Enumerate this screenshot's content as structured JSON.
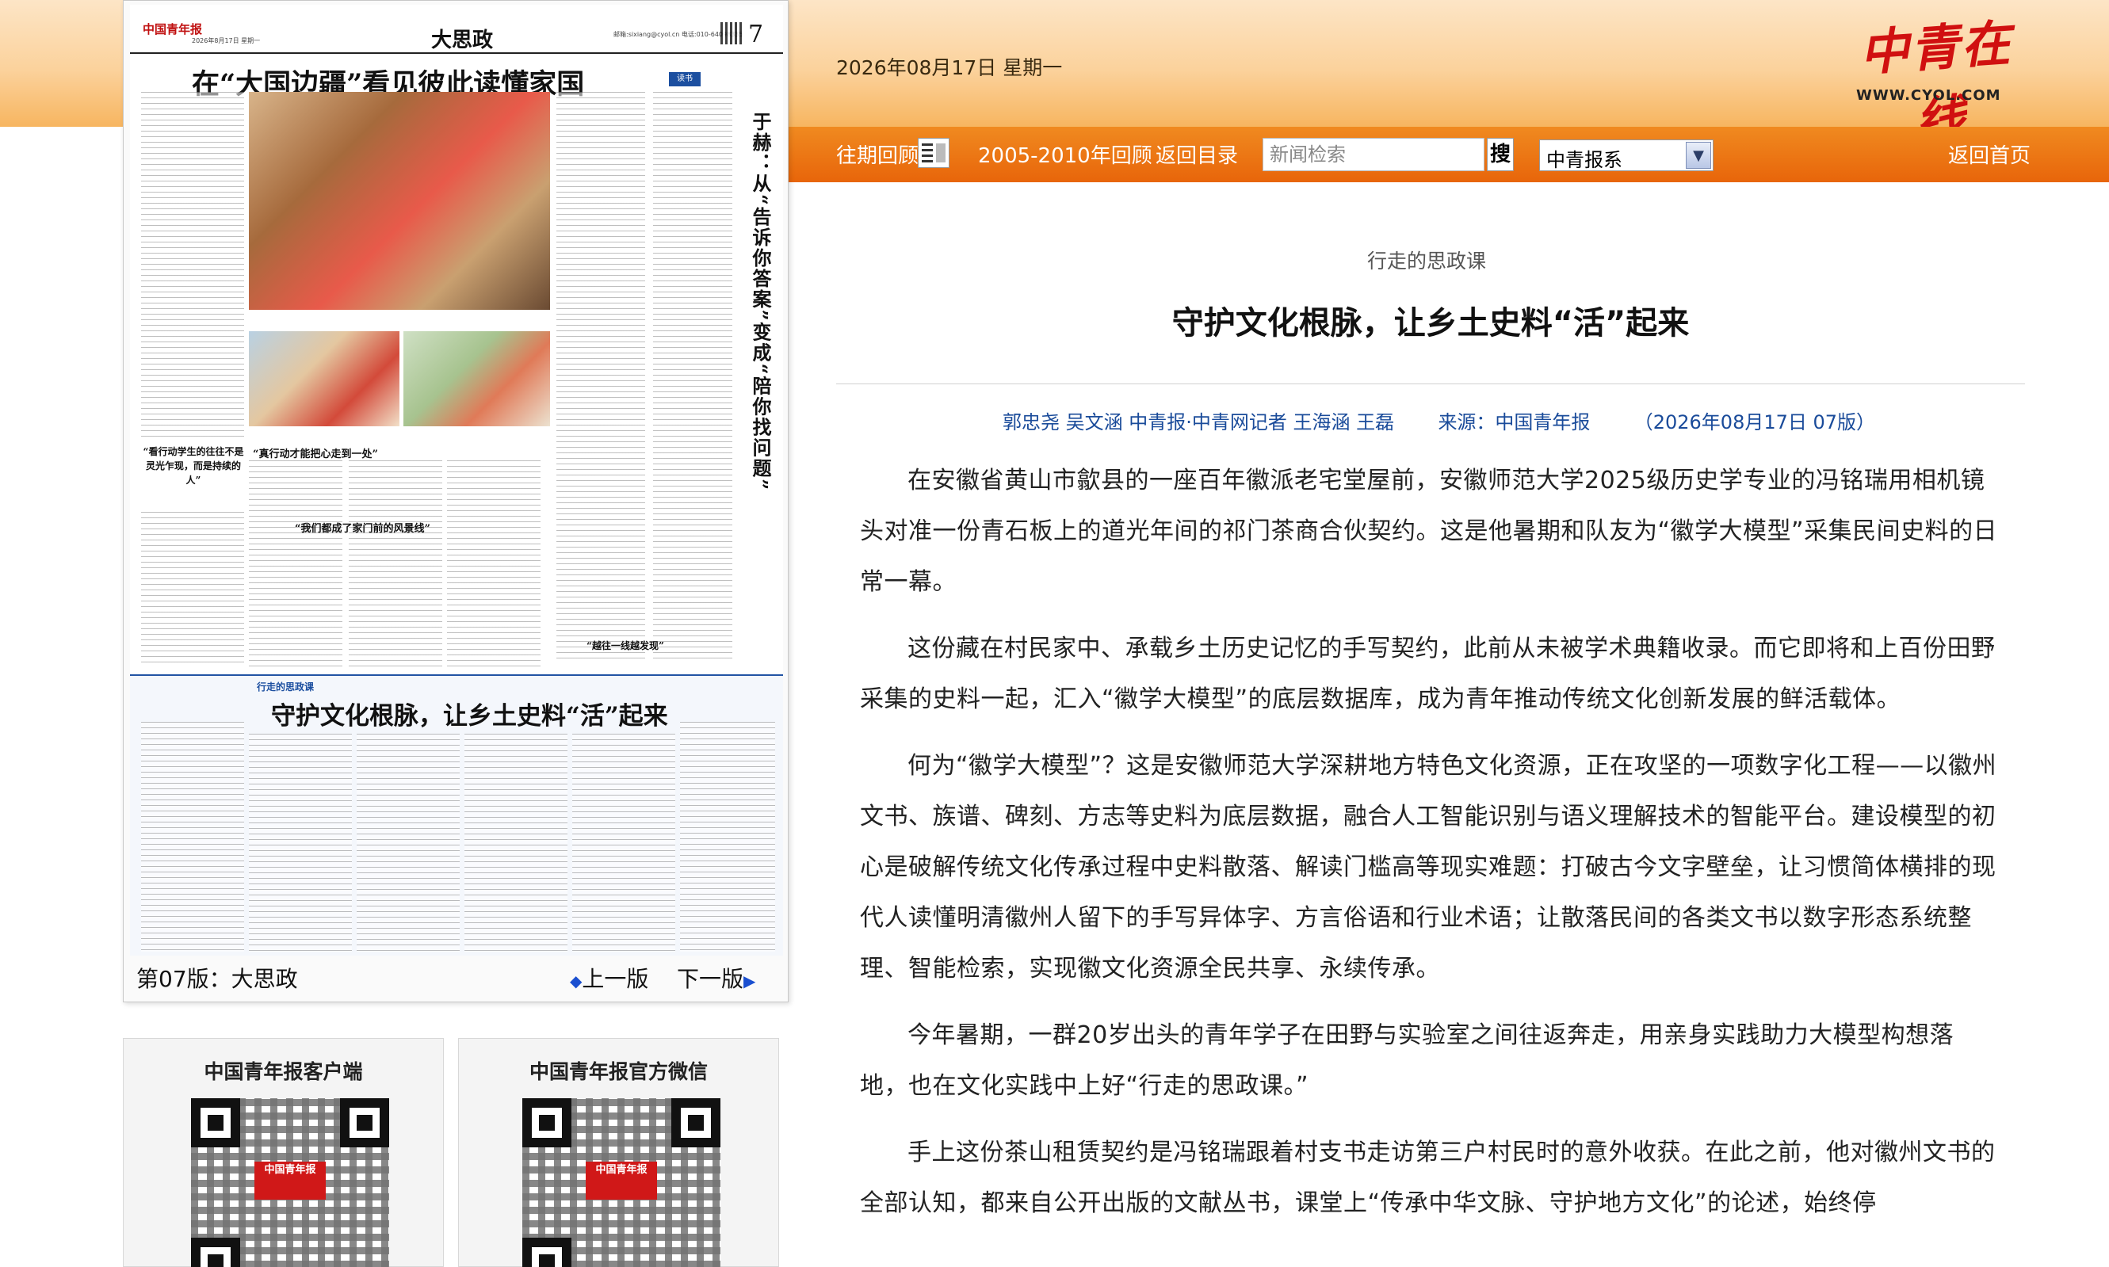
{
  "header": {
    "date": "2026年08月17日 星期一",
    "logo_text": "中青在线",
    "logo_url_text": "WWW.CYOL.COM"
  },
  "nav": {
    "past_review": "往期回顾",
    "archive_2005_2010": "2005-2010年回顾",
    "back_to_index": "返回目录",
    "search_placeholder": "新闻检索",
    "search_button": "搜",
    "select_value": "中青报系",
    "home": "返回首页"
  },
  "paper": {
    "logo": "中国青年报",
    "meta": "2026年8月17日 星期一",
    "section": "大思政",
    "contact": "邮箱:sixiang@cyol.cn 电话:010-64098335",
    "page_number": "7",
    "title_main": "在“大国边疆”看见彼此读懂家国",
    "vertical_title": "于赫：从“告诉你答案”变成“陪你找问题”",
    "tag_reader": "读书",
    "pull_quote": "“看行动学生的往往不是灵光乍现，而是持续的人”",
    "subhead_1": "“真行动才能把心走到一处”",
    "subhead_2": "“我们都成了家门前的风景线”",
    "pull_quote_2": "“越往一线越发现”",
    "tag_column": "行走的思政课",
    "title_second": "守护文化根脉，让乡土史料“活”起来",
    "footer_label": "第07版：大思政",
    "prev_page": "上一版",
    "next_page": "下一版"
  },
  "qr": {
    "client_title": "中国青年报客户端",
    "wechat_title": "中国青年报官方微信",
    "logo_text": "中国青年报"
  },
  "article": {
    "section": "行走的思政课",
    "title": "守护文化根脉，让乡土史料“活”起来",
    "authors": "郭忠尧 吴文涵 中青报·中青网记者 王海涵 王磊",
    "source": "来源：中国青年报",
    "date_page": "（2026年08月17日   07版）",
    "paragraphs": [
      "在安徽省黄山市歙县的一座百年徽派老宅堂屋前，安徽师范大学2025级历史学专业的冯铭瑞用相机镜头对准一份青石板上的道光年间的祁门茶商合伙契约。这是他暑期和队友为“徽学大模型”采集民间史料的日常一幕。",
      "这份藏在村民家中、承载乡土历史记忆的手写契约，此前从未被学术典籍收录。而它即将和上百份田野采集的史料一起，汇入“徽学大模型”的底层数据库，成为青年推动传统文化创新发展的鲜活载体。",
      "何为“徽学大模型”？这是安徽师范大学深耕地方特色文化资源，正在攻坚的一项数字化工程——以徽州文书、族谱、碑刻、方志等史料为底层数据，融合人工智能识别与语义理解技术的智能平台。建设模型的初心是破解传统文化传承过程中史料散落、解读门槛高等现实难题：打破古今文字壁垒，让习惯简体横排的现代人读懂明清徽州人留下的手写异体字、方言俗语和行业术语；让散落民间的各类文书以数字形态系统整理、智能检索，实现徽文化资源全民共享、永续传承。",
      "今年暑期，一群20岁出头的青年学子在田野与实验室之间往返奔走，用亲身实践助力大模型构想落地，也在文化实践中上好“行走的思政课。”",
      "手上这份茶山租赁契约是冯铭瑞跟着村支书走访第三户村民时的意外收获。在此之前，他对徽州文书的全部认知，都来自公开出版的文献丛书，课堂上“传承中华文脉、守护地方文化”的论述，始终停"
    ]
  },
  "colors": {
    "nav_orange": "#e8650a",
    "banner_light": "#fbd29c",
    "byline_blue": "#1a4b9a",
    "logo_red": "#d01010"
  }
}
